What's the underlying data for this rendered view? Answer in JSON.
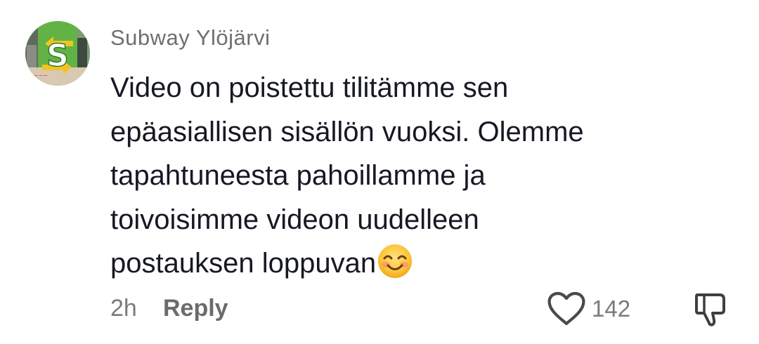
{
  "comment": {
    "author": "Subway Ylöjärvi",
    "avatar_icon": "subway-logo-icon",
    "text_lines": [
      "Video on poistettu tilitämme sen",
      "epäasiallisen sisällön vuoksi. Olemme",
      "tapahtuneesta pahoillamme ja",
      "toivoisimme videon uudelleen",
      "postauksen loppuvan"
    ],
    "emoji_icon": "smiling-face-emoji-icon",
    "timestamp": "2h",
    "reply_label": "Reply",
    "like_icon": "heart-outline-icon",
    "like_count": "142",
    "dislike_icon": "thumbs-down-icon"
  },
  "colors": {
    "author_text": "#6f6f6f",
    "body_text": "#161823",
    "meta_text": "#7a7a7a",
    "subway_green": "#3c9a2e",
    "subway_yellow": "#f3c324"
  }
}
